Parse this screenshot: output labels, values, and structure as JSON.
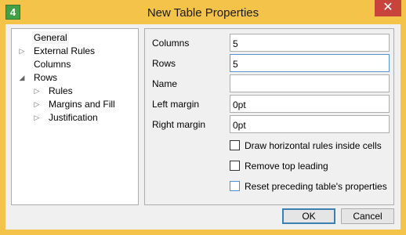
{
  "window": {
    "title": "New Table Properties",
    "app_icon_text": "4",
    "close_glyph": "✕"
  },
  "tree": {
    "items": [
      {
        "label": "General",
        "has_arrow": false,
        "expanded": false,
        "selected": true
      },
      {
        "label": "External Rules",
        "has_arrow": true,
        "expanded": false
      },
      {
        "label": "Columns",
        "has_arrow": false
      },
      {
        "label": "Rows",
        "has_arrow": true,
        "expanded": true
      },
      {
        "label": "Rules",
        "has_arrow": true,
        "expanded": false
      },
      {
        "label": "Margins and Fill",
        "has_arrow": true,
        "expanded": false
      },
      {
        "label": "Justification",
        "has_arrow": true,
        "expanded": false
      }
    ],
    "arrow_collapsed": "▷",
    "arrow_expanded": "◢"
  },
  "form": {
    "columns": {
      "label": "Columns",
      "value": "5"
    },
    "rows": {
      "label": "Rows",
      "value": "5"
    },
    "name": {
      "label": "Name",
      "value": ""
    },
    "left_margin": {
      "label": "Left margin",
      "value": "0pt"
    },
    "right_margin": {
      "label": "Right margin",
      "value": "0pt"
    }
  },
  "checks": {
    "draw_rules": {
      "label": "Draw horizontal rules inside cells",
      "checked": false
    },
    "remove_leading": {
      "label": "Remove top leading",
      "checked": false
    },
    "reset_props": {
      "label": "Reset preceding table's properties",
      "checked": false
    }
  },
  "buttons": {
    "ok": "OK",
    "cancel": "Cancel"
  },
  "colors": {
    "frame": "#f3c34a",
    "close": "#c7433b",
    "client": "#f0f0f0"
  }
}
